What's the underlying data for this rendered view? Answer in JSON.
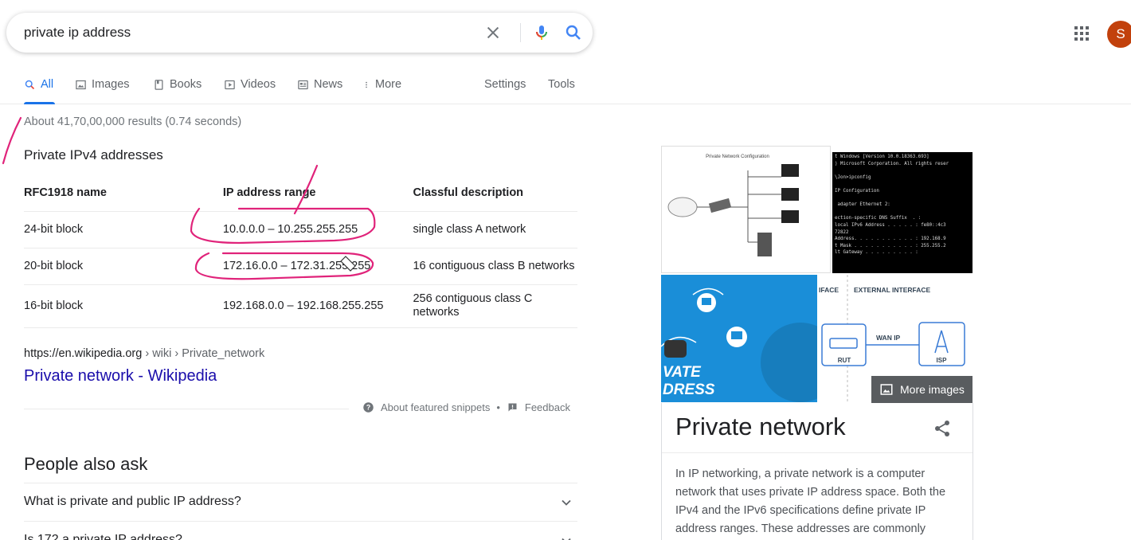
{
  "search": {
    "query": "private ip address"
  },
  "header": {
    "avatar_initial": "S"
  },
  "tabs": [
    {
      "label": "All",
      "icon": "search-icon",
      "active": true
    },
    {
      "label": "Images",
      "icon": "image-icon"
    },
    {
      "label": "Books",
      "icon": "book-icon"
    },
    {
      "label": "Videos",
      "icon": "play-icon"
    },
    {
      "label": "News",
      "icon": "news-icon"
    },
    {
      "label": "More",
      "icon": "more-vert-icon"
    }
  ],
  "tools": {
    "settings": "Settings",
    "tools": "Tools"
  },
  "stats": "About 41,70,00,000 results (0.74 seconds)",
  "snippet": {
    "title": "Private IPv4 addresses",
    "headers": [
      "RFC1918 name",
      "IP address range",
      "Classful description"
    ],
    "rows": [
      [
        "24-bit block",
        "10.0.0.0 – 10.255.255.255",
        "single class A network"
      ],
      [
        "20-bit block",
        "172.16.0.0 – 172.31.255.255",
        "16 contiguous class B networks"
      ],
      [
        "16-bit block",
        "192.168.0.0 – 192.168.255.255",
        "256 contiguous class C networks"
      ]
    ],
    "cite_domain": "https://en.wikipedia.org",
    "cite_path": " › wiki › Private_network",
    "result_title": "Private network - Wikipedia",
    "about_snippets": "About featured snippets",
    "bullet": "•",
    "feedback": "Feedback"
  },
  "paa": {
    "title": "People also ask",
    "questions": [
      "What is private and public IP address?",
      "Is 172 a private IP address?"
    ]
  },
  "knowledge_panel": {
    "more_images": "More images",
    "title": "Private network",
    "description": "In IP networking, a private network is a computer network that uses private IP address space. Both the IPv4 and the IPv6 specifications define private IP address ranges. These addresses are commonly",
    "images": {
      "diagram_caption": "Private Network Configuration",
      "console_lines": [
        "t Windows [Version 10.0.18363.693]",
        ") Microsoft Corporation. All rights reser",
        "",
        "\\Jon>ipconfig",
        "",
        "IP Configuration",
        "",
        " adapter Ethernet 2:",
        "",
        "ection-specific DNS Suffix  . :",
        "local IPv6 Address . . . . . : fe80::4c3",
        "72822",
        "Address. . . . . . . . . . . : 192.168.9",
        "t Mask . . . . . . . . . . . : 255.255.2",
        "lt Gateway . . . . . . . . . :"
      ],
      "blue_text": [
        "VATE",
        "DRESS"
      ],
      "iface_label": "IFACE",
      "external_label": "EXTERNAL INTERFACE",
      "wan_label": "WAN IP",
      "rut_label": "RUT",
      "isp_label": "ISP"
    }
  },
  "colors": {
    "link": "#1a0dab",
    "accent": "#1a73e8",
    "annotation": "#e0237a"
  }
}
